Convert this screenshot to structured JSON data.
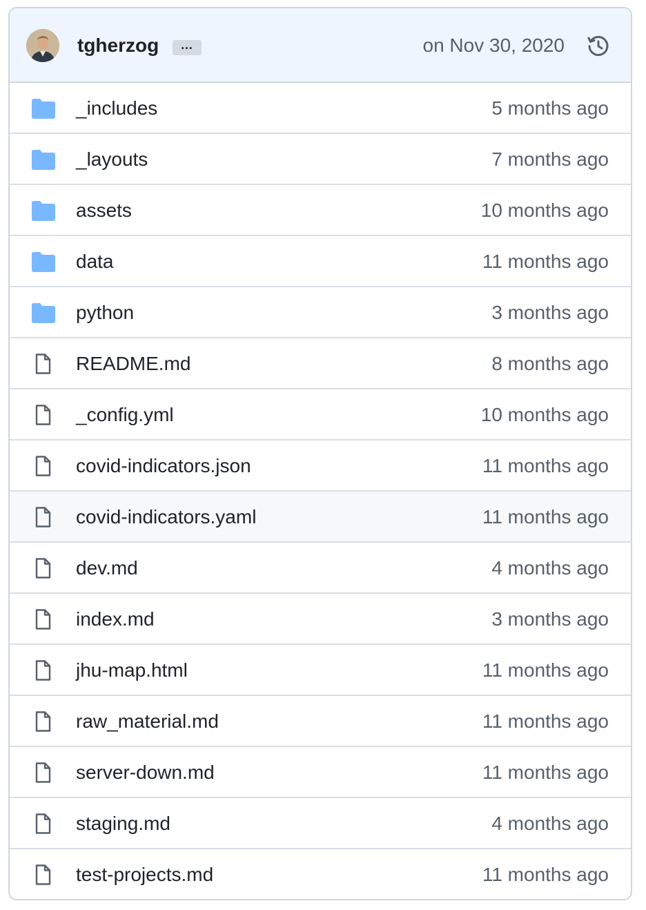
{
  "commit": {
    "author": "tgherzog",
    "ellipsis": "…",
    "date": "on Nov 30, 2020",
    "history_icon": "history-icon"
  },
  "colors": {
    "header_bg": "#eef5fe",
    "folder": "#79b8ff",
    "file_icon": "#57606a",
    "text": "#1f2328",
    "muted": "#57606a",
    "border": "#d0d7de"
  },
  "files": [
    {
      "name": "_includes",
      "type": "folder",
      "age": "5 months ago"
    },
    {
      "name": "_layouts",
      "type": "folder",
      "age": "7 months ago"
    },
    {
      "name": "assets",
      "type": "folder",
      "age": "10 months ago"
    },
    {
      "name": "data",
      "type": "folder",
      "age": "11 months ago"
    },
    {
      "name": "python",
      "type": "folder",
      "age": "3 months ago"
    },
    {
      "name": "README.md",
      "type": "file",
      "age": "8 months ago"
    },
    {
      "name": "_config.yml",
      "type": "file",
      "age": "10 months ago"
    },
    {
      "name": "covid-indicators.json",
      "type": "file",
      "age": "11 months ago"
    },
    {
      "name": "covid-indicators.yaml",
      "type": "file",
      "age": "11 months ago",
      "highlighted": true
    },
    {
      "name": "dev.md",
      "type": "file",
      "age": "4 months ago"
    },
    {
      "name": "index.md",
      "type": "file",
      "age": "3 months ago"
    },
    {
      "name": "jhu-map.html",
      "type": "file",
      "age": "11 months ago"
    },
    {
      "name": "raw_material.md",
      "type": "file",
      "age": "11 months ago"
    },
    {
      "name": "server-down.md",
      "type": "file",
      "age": "11 months ago"
    },
    {
      "name": "staging.md",
      "type": "file",
      "age": "4 months ago"
    },
    {
      "name": "test-projects.md",
      "type": "file",
      "age": "11 months ago"
    }
  ]
}
